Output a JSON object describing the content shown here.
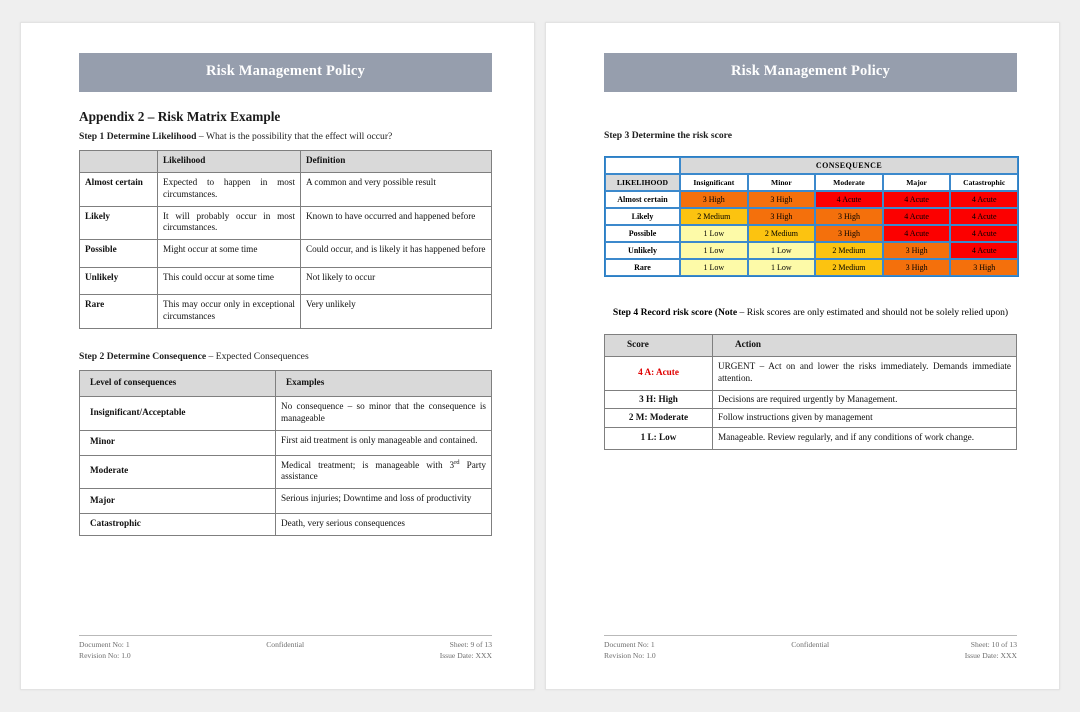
{
  "document": {
    "banner_title": "Risk Management Policy"
  },
  "left_page": {
    "appendix_heading": "Appendix 2 – Risk Matrix Example",
    "step1": {
      "label": "Step 1  Determine Likelihood",
      "rest": " – What is the possibility that the effect will occur?"
    },
    "likelihood_table": {
      "headers": [
        "",
        "Likelihood",
        "Definition"
      ],
      "rows": [
        {
          "level": "Almost certain",
          "likelihood": "Expected to happen in most circumstances.",
          "definition": "A common and very possible result"
        },
        {
          "level": "Likely",
          "likelihood": "It will probably occur in most circumstances.",
          "definition": "Known to have occurred and happened before"
        },
        {
          "level": "Possible",
          "likelihood": "Might occur at some time",
          "definition": "Could occur, and is likely it has happened before"
        },
        {
          "level": "Unlikely",
          "likelihood": "This could occur at some time",
          "definition": "Not likely to occur"
        },
        {
          "level": "Rare",
          "likelihood": "This may occur only in exceptional circumstances",
          "definition": "Very unlikely"
        }
      ]
    },
    "step2": {
      "label": "Step 2 Determine Consequence",
      "rest": " – Expected Consequences"
    },
    "consequence_table": {
      "headers": [
        "Level of consequences",
        "Examples"
      ],
      "rows": [
        {
          "level": "Insignificant/Acceptable",
          "example": "No consequence – so minor that the consequence is manageable"
        },
        {
          "level": "Minor",
          "example": "First aid treatment is only manageable and contained."
        },
        {
          "level": "Moderate",
          "example_pre": "Medical treatment; is manageable with 3",
          "example_sup": "rd",
          "example_post": " Party assistance"
        },
        {
          "level": "Major",
          "example": "Serious injuries; Downtime and loss of productivity"
        },
        {
          "level": "Catastrophic",
          "example": "Death, very serious consequences"
        }
      ]
    },
    "footer": {
      "doc_no": "Document No: 1",
      "rev_no": "Revision No: 1.0",
      "confidential": "Confidential",
      "sheet": "Sheet: 9 of 13",
      "issue_date": "Issue Date: XXX"
    }
  },
  "right_page": {
    "step3": {
      "label": "Step 3 Determine the risk score"
    },
    "risk_matrix": {
      "consequence_header": "CONSEQUENCE",
      "likelihood_header": "LIKELIHOOD",
      "consequence_levels": [
        "Insignificant",
        "Minor",
        "Moderate",
        "Major",
        "Catastrophic"
      ],
      "likelihood_levels": [
        "Almost certain",
        "Likely",
        "Possible",
        "Unlikely",
        "Rare"
      ],
      "colors": {
        "low": "#fdfaa8",
        "medium": "#fcc310",
        "high": "#f4700c",
        "acute": "#fc0000",
        "header": "#d9d9d9",
        "border": "#3c89cc"
      },
      "cells": [
        [
          {
            "label": "3 High",
            "level": "high"
          },
          {
            "label": "3 High",
            "level": "high"
          },
          {
            "label": "4 Acute",
            "level": "acute"
          },
          {
            "label": "4 Acute",
            "level": "acute"
          },
          {
            "label": "4 Acute",
            "level": "acute"
          }
        ],
        [
          {
            "label": "2 Medium",
            "level": "medium"
          },
          {
            "label": "3 High",
            "level": "high"
          },
          {
            "label": "3 High",
            "level": "high"
          },
          {
            "label": "4 Acute",
            "level": "acute"
          },
          {
            "label": "4 Acute",
            "level": "acute"
          }
        ],
        [
          {
            "label": "1 Low",
            "level": "low"
          },
          {
            "label": "2 Medium",
            "level": "medium"
          },
          {
            "label": "3 High",
            "level": "high"
          },
          {
            "label": "4 Acute",
            "level": "acute"
          },
          {
            "label": "4 Acute",
            "level": "acute"
          }
        ],
        [
          {
            "label": "1 Low",
            "level": "low"
          },
          {
            "label": "1 Low",
            "level": "low"
          },
          {
            "label": "2 Medium",
            "level": "medium"
          },
          {
            "label": "3 High",
            "level": "high"
          },
          {
            "label": "4 Acute",
            "level": "acute"
          }
        ],
        [
          {
            "label": "1 Low",
            "level": "low"
          },
          {
            "label": "1 Low",
            "level": "low"
          },
          {
            "label": "2 Medium",
            "level": "medium"
          },
          {
            "label": "3 High",
            "level": "high"
          },
          {
            "label": "3 High",
            "level": "high"
          }
        ]
      ]
    },
    "step4": {
      "label": "Step 4 Record risk score (Note",
      "rest": " – Risk scores are only estimated and should not be solely relied upon)"
    },
    "score_table": {
      "headers": [
        "Score",
        "Action"
      ],
      "rows": [
        {
          "score": "4 A: Acute",
          "highlight": true,
          "action": "URGENT – Act on and lower the risks immediately. Demands immediate attention."
        },
        {
          "score": "3 H: High",
          "highlight": false,
          "action": "Decisions are required urgently by Management."
        },
        {
          "score": "2 M: Moderate",
          "highlight": false,
          "action": "Follow instructions given by management"
        },
        {
          "score": "1 L: Low",
          "highlight": false,
          "action": "Manageable. Review regularly, and if any conditions of work change."
        }
      ]
    },
    "footer": {
      "doc_no": "Document No: 1",
      "rev_no": "Revision No: 1.0",
      "confidential": "Confidential",
      "sheet": "Sheet: 10 of 13",
      "issue_date": "Issue Date: XXX"
    }
  }
}
